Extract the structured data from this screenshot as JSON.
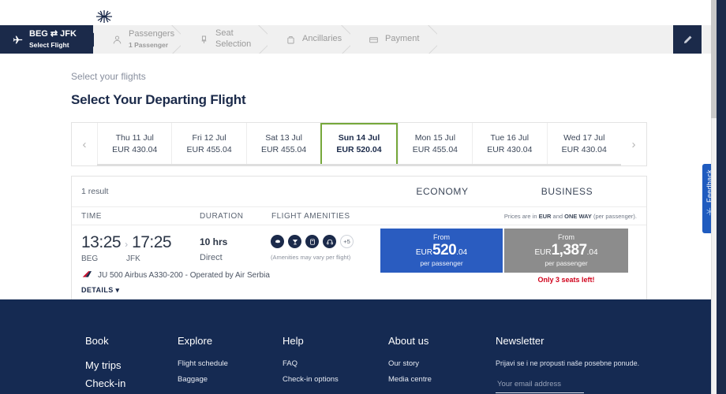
{
  "brand": {
    "logo_name": "air-serbia-logo",
    "accent_navy": "#1b2a4a",
    "accent_blue": "#2a5cc0",
    "accent_green": "#76a83b",
    "accent_red": "#d0021b",
    "footer_navy": "#152a52"
  },
  "stepper": {
    "edit_icon": "pencil-icon",
    "steps": [
      {
        "icon": "plane-icon",
        "main": "BEG ⇄ JFK",
        "sub": "Select Flight",
        "active": true
      },
      {
        "icon": "passenger-icon",
        "main": "Passengers",
        "sub": "1 Passenger",
        "active": false
      },
      {
        "icon": "seat-icon",
        "main": "Seat Selection",
        "sub": "",
        "active": false
      },
      {
        "icon": "bag-icon",
        "main": "Ancillaries",
        "sub": "",
        "active": false
      },
      {
        "icon": "card-icon",
        "main": "Payment",
        "sub": "",
        "active": false
      }
    ]
  },
  "page": {
    "breadcrumb": "Select your flights",
    "title": "Select Your Departing Flight"
  },
  "dates": {
    "prev_label": "‹",
    "next_label": "›",
    "items": [
      {
        "day": "Thu 11 Jul",
        "price": "EUR 430.04",
        "selected": false
      },
      {
        "day": "Fri 12 Jul",
        "price": "EUR 455.04",
        "selected": false
      },
      {
        "day": "Sat 13 Jul",
        "price": "EUR 455.04",
        "selected": false
      },
      {
        "day": "Sun 14 Jul",
        "price": "EUR 520.04",
        "selected": true
      },
      {
        "day": "Mon 15 Jul",
        "price": "EUR 455.04",
        "selected": false
      },
      {
        "day": "Tue 16 Jul",
        "price": "EUR 430.04",
        "selected": false
      },
      {
        "day": "Wed 17 Jul",
        "price": "EUR 430.04",
        "selected": false
      }
    ]
  },
  "results": {
    "count_label": "1 result",
    "cabin_economy": "ECONOMY",
    "cabin_business": "BUSINESS",
    "col_time": "TIME",
    "col_duration": "DURATION",
    "col_amenities": "FLIGHT AMENITIES",
    "price_note_pre": "Prices are in ",
    "price_note_cur": "EUR",
    "price_note_mid": " and ",
    "price_note_way": "ONE WAY",
    "price_note_post": " (per passenger).",
    "flight": {
      "depart_time": "13:25",
      "arrive_time": "17:25",
      "arrow": "›",
      "depart_code": "BEG",
      "arrive_code": "JFK",
      "duration": "10 hrs",
      "stops": "Direct",
      "amenity_icons": [
        "meal-icon",
        "drink-icon",
        "entertainment-icon",
        "headphones-icon"
      ],
      "amenity_more": "+5",
      "amenity_note": "(Amenities may vary per flight)",
      "aircraft": "JU 500  Airbus A330-200  -  Operated by Air Serbia",
      "details_label": "DETAILS",
      "details_caret": "▾"
    },
    "fares": [
      {
        "name": "economy",
        "from": "From",
        "currency": "EUR",
        "whole": "520",
        "decimal": ".04",
        "per": "per passenger"
      },
      {
        "name": "business",
        "from": "From",
        "currency": "EUR",
        "whole": "1,387",
        "decimal": ".04",
        "per": "per passenger"
      }
    ],
    "seats_left": "Only 3 seats left!"
  },
  "footer": {
    "columns": [
      {
        "head": "Book",
        "items": [
          "My trips",
          "Check-in"
        ]
      },
      {
        "head": "Explore",
        "items": [
          "Flight schedule",
          "Baggage"
        ]
      },
      {
        "head": "Help",
        "items": [
          "FAQ",
          "Check-in options"
        ]
      },
      {
        "head": "About us",
        "items": [
          "Our story",
          "Media centre"
        ]
      }
    ],
    "newsletter": {
      "head": "Newsletter",
      "text": "Prijavi se i ne propusti naše posebne ponude.",
      "placeholder": "Your email address",
      "value": ""
    }
  },
  "feedback": {
    "label": "Feedback",
    "icon": "snowflake-icon"
  }
}
